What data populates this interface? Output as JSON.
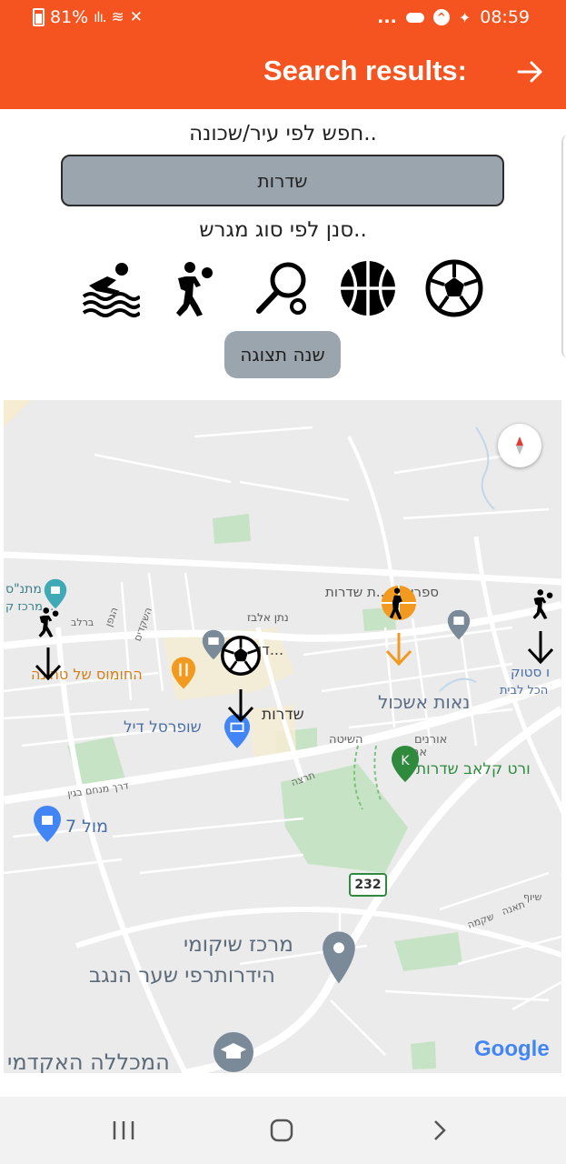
{
  "status_bar": {
    "battery": "81%",
    "time": "08:59",
    "dots": "..."
  },
  "header": {
    "title": "Search results:"
  },
  "search": {
    "label": "חפש לפי עיר/שכונה..",
    "value": "שדרות"
  },
  "filter": {
    "label": "סנן לפי סוג מגרש..",
    "types": [
      "soccer-icon",
      "basketball-icon",
      "tennis-icon",
      "handball-icon",
      "swimming-icon"
    ]
  },
  "toggle_button": "שנה תצוגה",
  "map": {
    "labels": {
      "sapir": "ספריה ע...ת שדרות",
      "natan": "נתן אלבז",
      "doar": "דואר יש...",
      "matnas": "מתנ\"ס",
      "mercaz": "מרכז ק...",
      "hummus": "החומוס של טחינה",
      "super": "שופרסל דיל",
      "sderot": "שדרות",
      "neot": "נאות אשכול",
      "country": "ורט קלאב שדרות",
      "sport": "ו סטוק",
      "hakol": "הכל לבית",
      "mall": "מול 7",
      "rehab1": "מרכז שיקומי",
      "rehab2": "הידרותרפי שער הנגב",
      "college": "המכללה האקדמי",
      "route": "232",
      "street_hashita": "השיטה",
      "street_oranim": "אורנים",
      "street_arazim": "ארזים",
      "street_menachem": "דרך מנחם בגין",
      "street_barlev": "ברלב",
      "street_hagefen": "הגפן",
      "street_hashkedim": "השקדים",
      "street_tirza": "תרצה",
      "street_siyuf": "שיוף",
      "street_taanah": "תאנה",
      "street_shikma": "שקמה"
    },
    "google": "Google"
  },
  "colors": {
    "accent": "#f5531f",
    "button_gray": "#9ba5ad",
    "map_bg": "#ebebeb",
    "map_green": "#c7e3c5",
    "marker_blue": "#4285f4",
    "marker_orange": "#f29a1f",
    "marker_gray": "#7b8a99",
    "map_text_blue": "#4a6fa5",
    "map_text_green": "#2f8a3d",
    "map_text_orange": "#d1801a"
  }
}
